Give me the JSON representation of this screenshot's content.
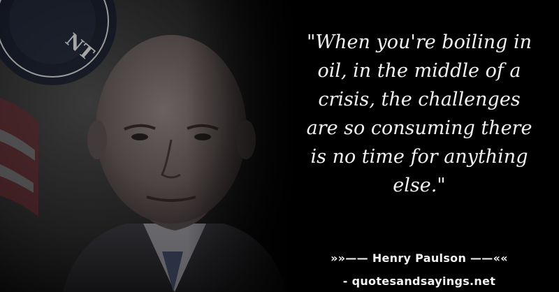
{
  "quote": {
    "text": "\"When you're boiling in oil, in the middle of a crisis, the challenges are so consuming there is no time for anything else.\""
  },
  "author": {
    "line": "»»—— Henry Paulson ——««"
  },
  "source": {
    "site": "- quotesandsayings.net"
  },
  "colors": {
    "background": "#000000",
    "text": "#f2f2f2"
  }
}
